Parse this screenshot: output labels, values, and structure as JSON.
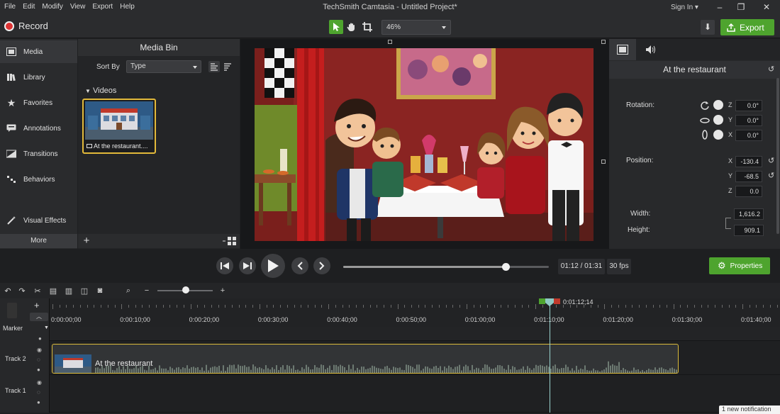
{
  "window": {
    "title": "TechSmith Camtasia - Untitled Project*",
    "menus": [
      "File",
      "Edit",
      "Modify",
      "View",
      "Export",
      "Help"
    ],
    "sign_in": "Sign In"
  },
  "toolbar": {
    "record_label": "Record",
    "zoom_value": "46%",
    "export_label": "Export",
    "tools": [
      "select-arrow-icon",
      "hand-pan-icon",
      "crop-icon"
    ],
    "active_tool": "select-arrow-icon",
    "accent_color": "#4ea42e"
  },
  "sidebar": {
    "items": [
      {
        "label": "Media",
        "icon": "film-strip-icon"
      },
      {
        "label": "Library",
        "icon": "library-books-icon"
      },
      {
        "label": "Favorites",
        "icon": "star-icon"
      },
      {
        "label": "Annotations",
        "icon": "annotation-icon"
      },
      {
        "label": "Transitions",
        "icon": "transition-icon"
      },
      {
        "label": "Behaviors",
        "icon": "behaviors-icon"
      },
      {
        "label": "Visual Effects",
        "icon": "magic-wand-icon"
      }
    ],
    "active_item": "Media",
    "more_label": "More"
  },
  "media_bin": {
    "title": "Media Bin",
    "sort_by_label": "Sort By",
    "sort_by_value": "Type",
    "group_label": "Videos",
    "clip_name": "At the restaurant...."
  },
  "properties": {
    "title": "At the restaurant",
    "rotation_label": "Rotation:",
    "rotation": {
      "z": "0.0°",
      "y": "0.0°",
      "x": "0.0°"
    },
    "position_label": "Position:",
    "position": {
      "x": "-130.4",
      "y": "-68.5",
      "z": "0.0"
    },
    "width_label": "Width:",
    "width": "1,616.2",
    "height_label": "Height:",
    "height": "909.1",
    "axis_labels": {
      "z": "Z",
      "y": "Y",
      "x": "X"
    },
    "properties_button": "Properties"
  },
  "playback": {
    "time": "01:12 / 01:31",
    "fps": "30 fps",
    "progress": 0.79
  },
  "timeline": {
    "ruler_labels": [
      "0:00:00;00",
      "0:00:10;00",
      "0:00:20;00",
      "0:00:30;00",
      "0:00:40;00",
      "0:00:50;00",
      "0:01:00;00",
      "0:01:10;00",
      "0:01:20;00",
      "0:01:30;00",
      "0:01:40;00"
    ],
    "playhead_time": "0:01:12;14",
    "playhead_seconds": 72.47,
    "marker_label": "Marker",
    "tracks": [
      {
        "name": "Track 2",
        "clip_name": "At the restaurant",
        "clip_start_seconds": 0,
        "clip_end_seconds": 91
      },
      {
        "name": "Track 1"
      }
    ]
  },
  "notification": "1 new notification"
}
